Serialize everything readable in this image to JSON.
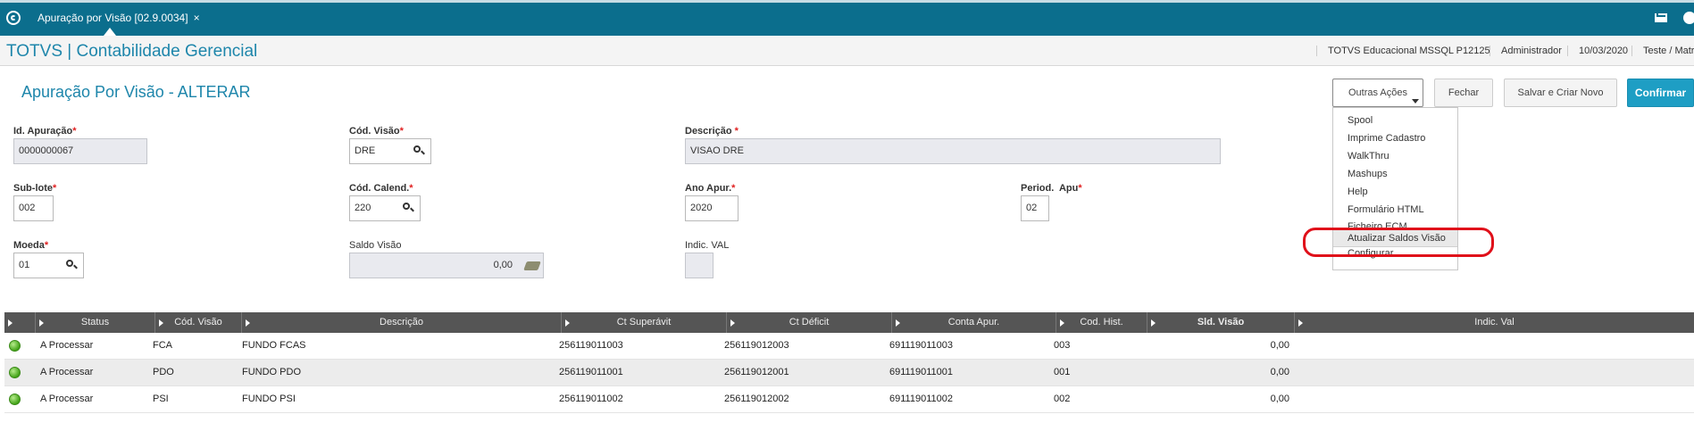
{
  "topbar": {
    "tab_label": "Apuração por Visão [02.9.0034]",
    "tab_close": "×"
  },
  "header": {
    "app_title": "TOTVS | Contabilidade Gerencial",
    "environment": "TOTVS Educacional MSSQL P12125",
    "user": "Administrador",
    "date": "10/03/2020",
    "branch": "Teste / Matr"
  },
  "page": {
    "title": "Apuração Por Visão - ALTERAR"
  },
  "toolbar": {
    "outras_acoes": "Outras Ações",
    "fechar": "Fechar",
    "salvar_criar": "Salvar e Criar Novo",
    "confirmar": "Confirmar"
  },
  "menu": {
    "items": [
      "Spool",
      "Imprime Cadastro",
      "WalkThru",
      "Mashups",
      "Help",
      "Formulário HTML",
      "Ficheiro ECM",
      "Atualizar Saldos Visão",
      "Configurar"
    ]
  },
  "form": {
    "id_apuracao": {
      "label": "Id. Apuração",
      "value": "0000000067"
    },
    "cod_visao": {
      "label": "Cód. Visão",
      "value": "DRE"
    },
    "descricao": {
      "label": "Descrição",
      "value": "VISAO DRE"
    },
    "sub_lote": {
      "label": "Sub-lote",
      "value": "002"
    },
    "cod_calend": {
      "label": "Cód. Calend.",
      "value": "220"
    },
    "ano_apur": {
      "label": "Ano Apur.",
      "value": "2020"
    },
    "period_apu": {
      "label": "Period.  Apu",
      "value": "02"
    },
    "moeda": {
      "label": "Moeda",
      "value": "01"
    },
    "saldo_visao": {
      "label": "Saldo Visão",
      "value": "0,00"
    },
    "indic_val": {
      "label": "Indic. VAL",
      "value": ""
    },
    "required_mark": "*"
  },
  "grid": {
    "columns": [
      "Status",
      "Cód. Visão",
      "Descrição",
      "Ct Superávit",
      "Ct Déficit",
      "Conta Apur.",
      "Cod. Hist.",
      "Sld. Visão",
      "Indic. Val"
    ],
    "rows": [
      {
        "status": "A Processar",
        "cod_visao": "FCA",
        "descricao": "FUNDO FCAS",
        "ct_superavit": "256119011003",
        "ct_deficit": "256119012003",
        "conta_apur": "691119011003",
        "cod_hist": "003",
        "sld_visao": "0,00",
        "indic_val": ""
      },
      {
        "status": "A Processar",
        "cod_visao": "PDO",
        "descricao": "FUNDO PDO",
        "ct_superavit": "256119011001",
        "ct_deficit": "256119012001",
        "conta_apur": "691119011001",
        "cod_hist": "001",
        "sld_visao": "0,00",
        "indic_val": ""
      },
      {
        "status": "A Processar",
        "cod_visao": "PSI",
        "descricao": "FUNDO PSI",
        "ct_superavit": "256119011002",
        "ct_deficit": "256119012002",
        "conta_apur": "691119011002",
        "cod_hist": "002",
        "sld_visao": "0,00",
        "indic_val": ""
      }
    ]
  },
  "colors": {
    "topbar": "#0b6e8d",
    "accent": "#1e86ab",
    "primary_button": "#1e9ec4",
    "highlight_ring": "#e0101a",
    "status_ok": "#43a318"
  },
  "icons": [
    "totvs-logo-icon",
    "mail-icon",
    "help-icon",
    "search-icon",
    "money-icon",
    "status-green-icon"
  ]
}
